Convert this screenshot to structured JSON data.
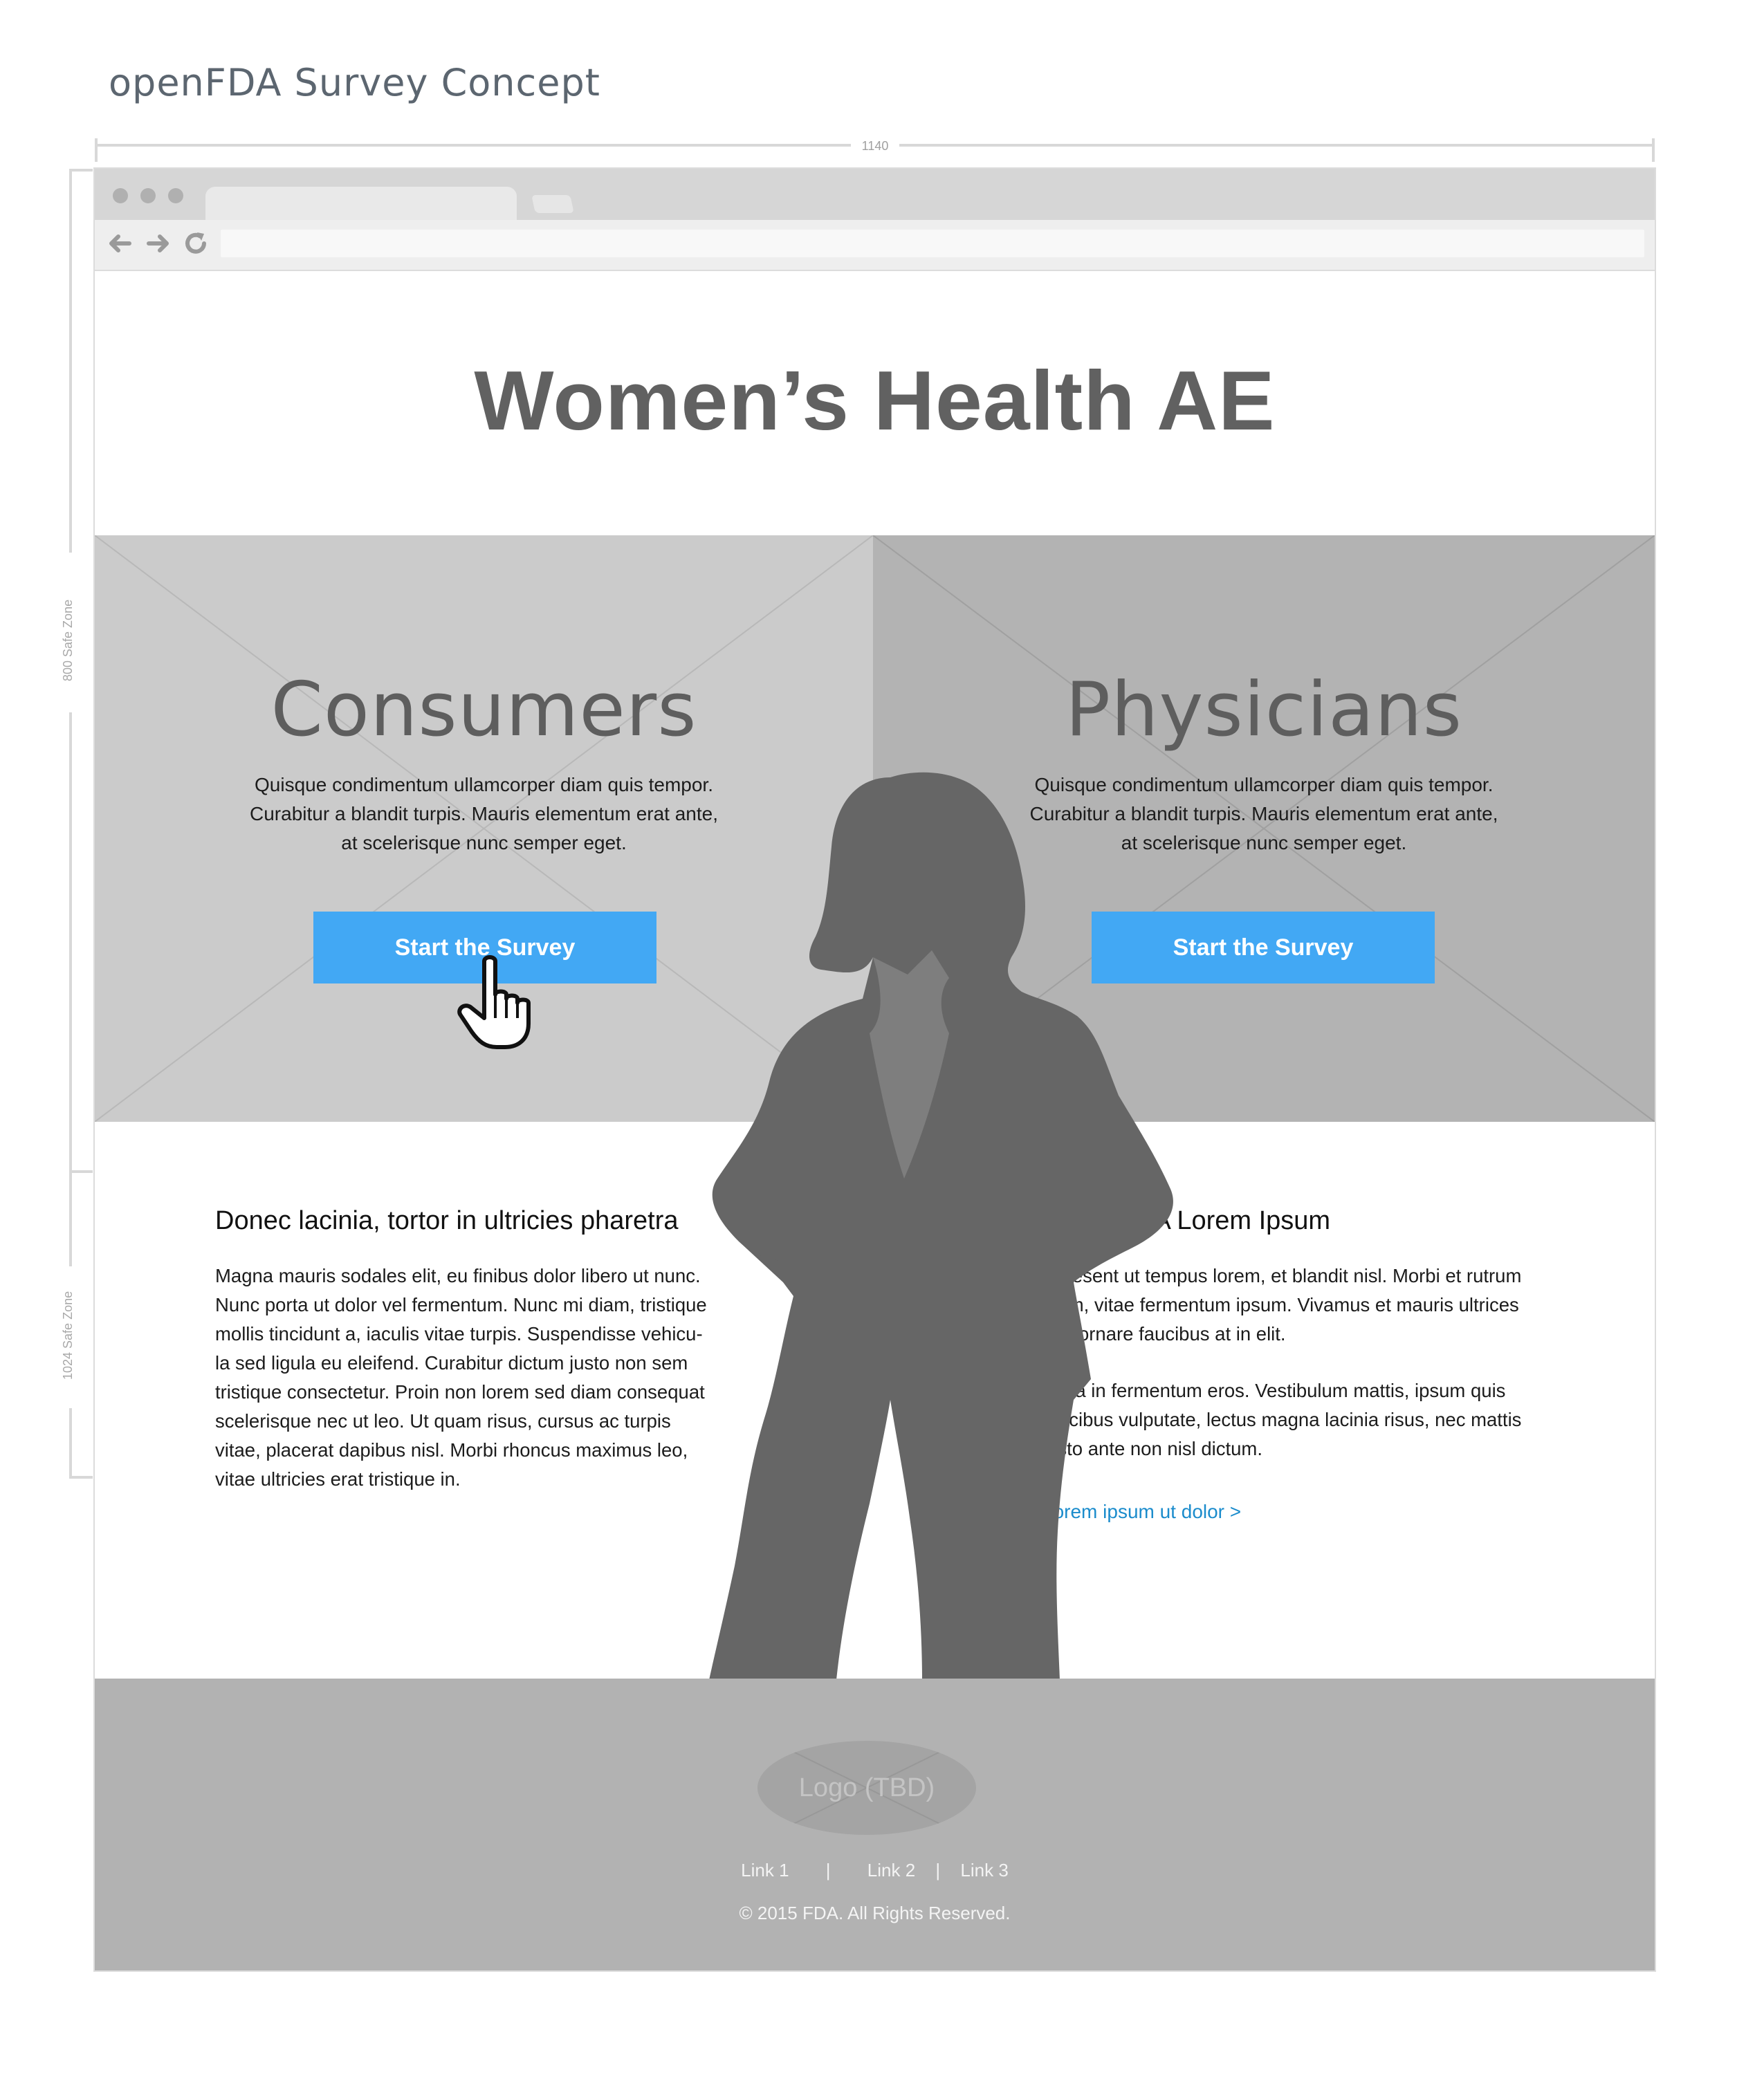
{
  "doc_title": "openFDA Survey Concept",
  "dimensions": {
    "width_label": "1140",
    "safe_zone_800": "800 Safe Zone",
    "safe_zone_1024": "1024 Safe Zone"
  },
  "browser": {
    "back_icon": "arrow-left-icon",
    "forward_icon": "arrow-right-icon",
    "reload_icon": "reload-icon"
  },
  "page": {
    "hero_title": "Women’s Health AE",
    "consumers": {
      "heading": "Consumers",
      "body": "Quisque condimentum ullamcorper diam quis tempor.\nCurabitur a blandit turpis. Mauris elementum erat ante,\nat scelerisque nunc semper eget.",
      "cta": "Start the Survey"
    },
    "physicians": {
      "heading": "Physicians",
      "body": "Quisque condimentum ullamcorper diam quis tempor.\nCurabitur a blandit turpis. Mauris elementum erat ante,\nat scelerisque nunc semper eget.",
      "cta": "Start the Survey"
    },
    "left_column": {
      "heading": "Donec lacinia, tortor in ultricies pharetra",
      "body": "Magna mauris sodales elit, eu finibus dolor libero ut nunc.\nNunc porta ut dolor vel fermentum. Nunc mi diam, tristique\nmollis tincidunt a, iaculis vitae turpis. Suspendisse vehicu-\nla sed ligula eu eleifend. Curabitur dictum justo non sem\ntristique consectetur. Proin non lorem sed diam consequat\nscelerisque nec ut leo. Ut quam risus, cursus ac turpis\nvitae, placerat dapibus nisl. Morbi rhoncus maximus leo,\nvitae ultricies erat tristique in."
    },
    "right_column": {
      "heading": "About FDA Lorem Ipsum",
      "para1": "Praesent ut tempus lorem, et blandit nisl. Morbi et rutrum\ndiam, vitae fermentum ipsum. Vivamus et mauris ultrices\norci ornare faucibus at in elit.",
      "para2": "Nulla in fermentum eros. Vestibulum mattis, ipsum quis\nfaucibus vulputate, lectus magna lacinia risus, nec mattis\njusto ante non nisl dictum.",
      "link": "Lorem ipsum ut dolor >"
    },
    "footer": {
      "logo": "Logo (TBD)",
      "links": [
        "Link 1",
        "Link 2",
        "Link 3"
      ],
      "separator": "|",
      "copyright": "© 2015 FDA. All Rights Reserved."
    }
  },
  "colors": {
    "cta": "#42a8f4",
    "link": "#1b8ccc",
    "silhouette": "#666666",
    "panel_left": "#cbcbcb",
    "panel_right": "#b3b3b3",
    "footer": "#b2b2b2"
  }
}
